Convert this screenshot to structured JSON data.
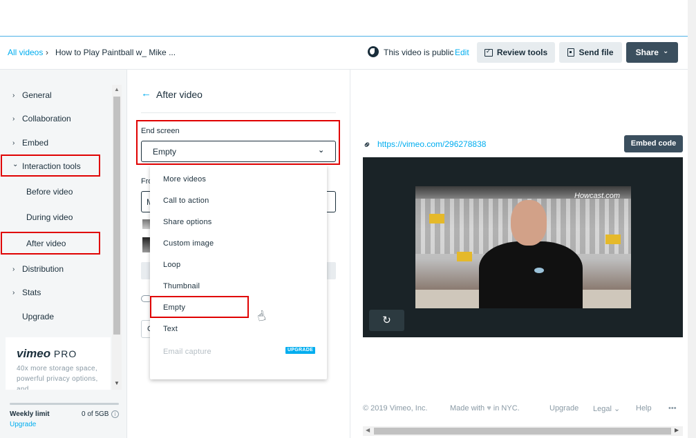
{
  "header": {
    "breadcrumb_link": "All videos",
    "breadcrumb_sep": "›",
    "video_title": "How to Play Paintball w_ Mike ...",
    "visibility_text": "This video is public",
    "edit_label": "Edit",
    "review_tools_label": "Review tools",
    "send_file_label": "Send file",
    "share_label": "Share",
    "share_chevron": "⌄"
  },
  "sidebar": {
    "items": [
      {
        "label": "General",
        "chevron": "›"
      },
      {
        "label": "Collaboration",
        "chevron": "›"
      },
      {
        "label": "Embed",
        "chevron": "›"
      },
      {
        "label": "Interaction tools",
        "chevron": "⌄"
      },
      {
        "label": "Distribution",
        "chevron": "›"
      },
      {
        "label": "Stats",
        "chevron": "›"
      }
    ],
    "sub_items": [
      "Before video",
      "During video",
      "After video"
    ],
    "upgrade_label": "Upgrade",
    "promo": {
      "logo": "vimeo",
      "logo_pro": "PRO",
      "text": "40x more storage space, powerful privacy options, and"
    },
    "weekly_limit": {
      "label": "Weekly limit",
      "value": "0 of 5GB",
      "info_icon": "i",
      "upgrade": "Upgrade",
      "used_fraction": 0
    }
  },
  "panel": {
    "back_icon": "←",
    "title": "After video",
    "end_screen_label": "End screen",
    "end_screen_value": "Empty",
    "select_chevron": "⌄",
    "hidden_label_fragment": "Fro",
    "hidden_input_fragment": "M",
    "hidden_button_fragment": "C",
    "dropdown_options": [
      {
        "label": "More videos",
        "disabled": false
      },
      {
        "label": "Call to action",
        "disabled": false
      },
      {
        "label": "Share options",
        "disabled": false
      },
      {
        "label": "Custom image",
        "disabled": false
      },
      {
        "label": "Loop",
        "disabled": false
      },
      {
        "label": "Thumbnail",
        "disabled": false
      },
      {
        "label": "Empty",
        "disabled": false
      },
      {
        "label": "Text",
        "disabled": false
      },
      {
        "label": "Email capture",
        "disabled": true
      }
    ],
    "upgrade_badge": "UPGRADE"
  },
  "preview": {
    "link_icon": "⚭",
    "video_url": "https://vimeo.com/296278838",
    "embed_code_label": "Embed code",
    "watermark": "Howcast.com",
    "replay_icon": "↻"
  },
  "footer": {
    "copyright": "© 2019 Vimeo, Inc.",
    "made_with": "Made with",
    "heart": "♥",
    "in_nyc": "in NYC.",
    "upgrade": "Upgrade",
    "legal": "Legal",
    "legal_chevron": "⌄",
    "help": "Help",
    "more": "•••"
  },
  "scrollbars": {
    "up": "▲",
    "down": "▼",
    "left": "◀",
    "right": "▶"
  },
  "colors": {
    "accent": "#00adef",
    "highlight": "#e00000",
    "dark_button": "#3b4f5e"
  }
}
